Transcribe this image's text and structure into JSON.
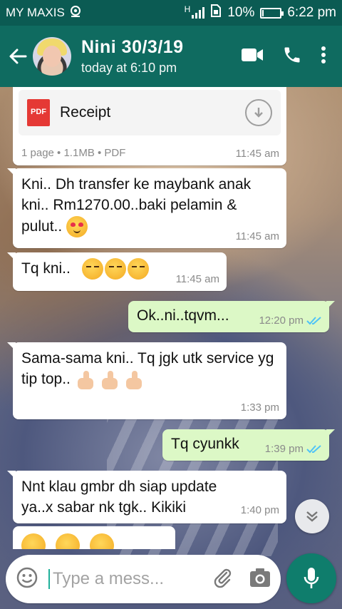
{
  "status_bar": {
    "carrier": "MY MAXIS",
    "network_type": "H",
    "battery_percent": "10%",
    "battery_level": 0.1,
    "time": "6:22 pm"
  },
  "header": {
    "contact_name": "Nini 30/3/19",
    "last_seen": "today at 6:10 pm"
  },
  "messages": [
    {
      "direction": "incoming",
      "type": "document",
      "top_partial_text": "Receipt",
      "file_name": "Receipt",
      "file_badge": "PDF",
      "meta": "1 page • 1.1MB • PDF",
      "time": "11:45 am"
    },
    {
      "direction": "incoming",
      "type": "text",
      "text": "Kni.. Dh transfer ke maybank anak kni.. Rm1270.00..baki pelamin & pulut..",
      "emojis": [
        "smiling-face-with-heart-eyes"
      ],
      "time": "11:45 am"
    },
    {
      "direction": "incoming",
      "type": "text",
      "text": "Tq kni..",
      "emojis": [
        "face-blowing-a-kiss",
        "face-blowing-a-kiss",
        "face-blowing-a-kiss"
      ],
      "time": "11:45 am"
    },
    {
      "direction": "outgoing",
      "type": "text",
      "text": "Ok..ni..tqvm...",
      "time": "12:20 pm",
      "status": "read"
    },
    {
      "direction": "incoming",
      "type": "text",
      "text": "Sama-sama kni.. Tq jgk utk service yg tip top..",
      "emojis": [
        "thumbs-up-light-skin",
        "thumbs-up-light-skin",
        "thumbs-up-light-skin"
      ],
      "time": "1:33 pm"
    },
    {
      "direction": "outgoing",
      "type": "text",
      "text": "Tq cyunkk",
      "time": "1:39 pm",
      "status": "read"
    },
    {
      "direction": "incoming",
      "type": "text",
      "text": "Nnt klau gmbr dh siap update ya..x sabar nk tgk.. Kikiki",
      "time": "1:40 pm"
    },
    {
      "direction": "incoming",
      "type": "emoji",
      "emojis": [
        "grinning-face",
        "grinning-face",
        "grinning-face"
      ]
    }
  ],
  "input": {
    "placeholder": "Type a mess..."
  },
  "colors": {
    "status_bar": "#0b5b53",
    "header": "#0f6b60",
    "incoming_bubble": "#ffffff",
    "outgoing_bubble": "#dcf8c6",
    "read_ticks": "#4fc3f7",
    "mic_button": "#0f7d6c"
  }
}
